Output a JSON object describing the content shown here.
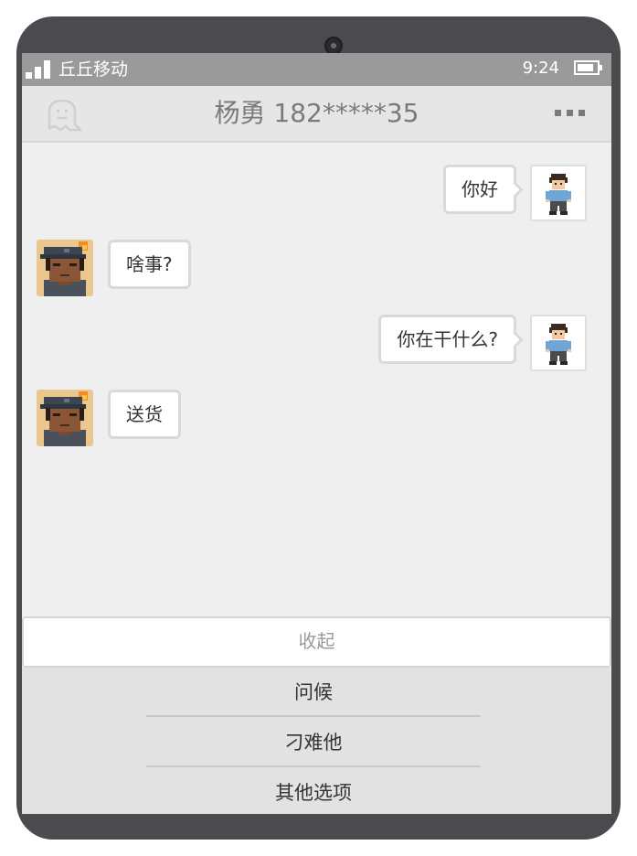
{
  "status_bar": {
    "carrier": "丘丘移动",
    "time": "9:24",
    "signal_icon": "signal-bars-icon",
    "battery_icon": "battery-icon"
  },
  "header": {
    "title": "杨勇 182*****35",
    "back_icon": "ghost-back-icon",
    "more_icon": "more-dots-icon"
  },
  "messages": [
    {
      "sender": "me",
      "text": "你好"
    },
    {
      "sender": "other",
      "text": "啥事?"
    },
    {
      "sender": "me",
      "text": "你在干什么?"
    },
    {
      "sender": "other",
      "text": "送货"
    }
  ],
  "collapse_label": "收起",
  "options": [
    {
      "label": "问候"
    },
    {
      "label": "刁难他"
    },
    {
      "label": "其他选项"
    }
  ],
  "colors": {
    "device_frame": "#4b4b4f",
    "status_bar": "#9a9a9a",
    "header_bg": "#e6e6e6",
    "chat_bg": "#efefef",
    "options_bg": "#e2e2e2"
  }
}
